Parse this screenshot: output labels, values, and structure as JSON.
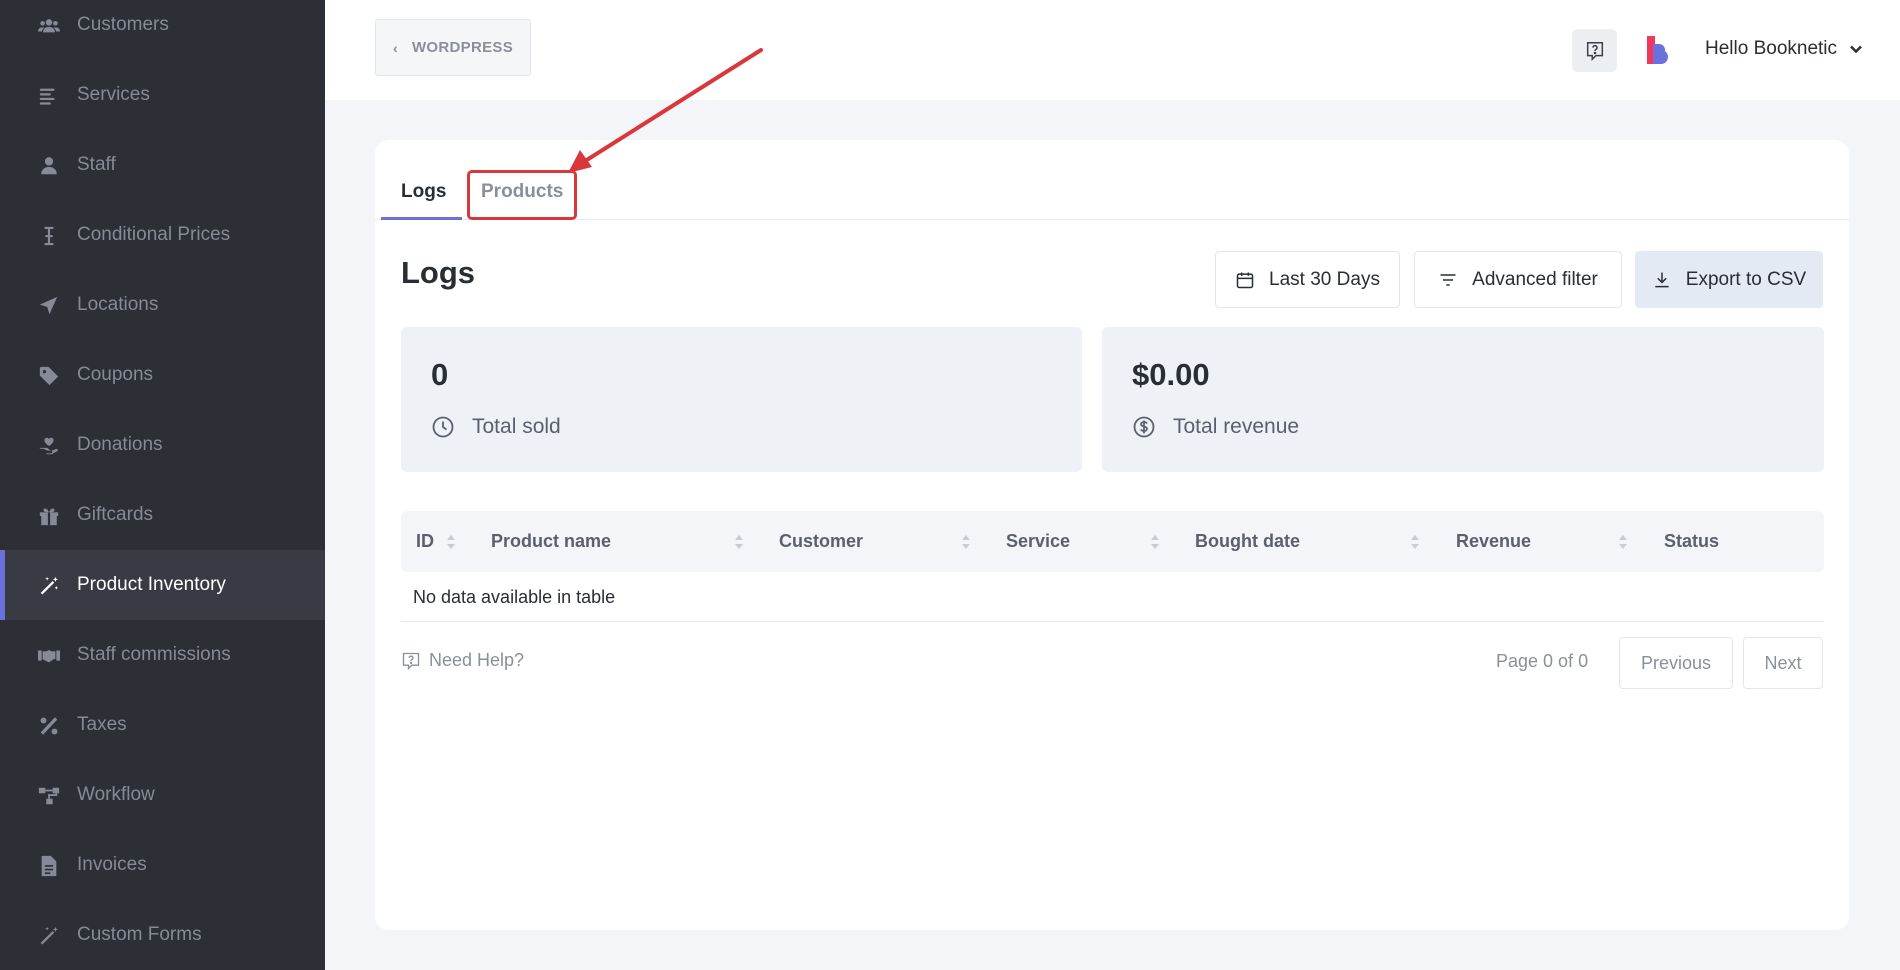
{
  "sidebar": {
    "items": [
      {
        "label": "Customers",
        "icon": "users-icon"
      },
      {
        "label": "Services",
        "icon": "list-icon"
      },
      {
        "label": "Staff",
        "icon": "user-icon"
      },
      {
        "label": "Conditional Prices",
        "icon": "cursor-icon"
      },
      {
        "label": "Locations",
        "icon": "location-arrow-icon"
      },
      {
        "label": "Coupons",
        "icon": "tag-icon"
      },
      {
        "label": "Donations",
        "icon": "hand-heart-icon"
      },
      {
        "label": "Giftcards",
        "icon": "gift-icon"
      },
      {
        "label": "Product Inventory",
        "icon": "magic-wand-icon",
        "active": true
      },
      {
        "label": "Staff commissions",
        "icon": "handshake-icon"
      },
      {
        "label": "Taxes",
        "icon": "percent-icon"
      },
      {
        "label": "Workflow",
        "icon": "workflow-icon"
      },
      {
        "label": "Invoices",
        "icon": "file-icon"
      },
      {
        "label": "Custom Forms",
        "icon": "magic-wand-icon"
      }
    ]
  },
  "topbar": {
    "back_label": "WORDPRESS",
    "user_label": "Hello Booknetic"
  },
  "tabs": [
    {
      "label": "Logs",
      "active": true
    },
    {
      "label": "Products",
      "active": false
    }
  ],
  "main": {
    "title": "Logs",
    "date_filter_label": "Last 30 Days",
    "advanced_filter_label": "Advanced filter",
    "export_label": "Export to CSV",
    "stats": {
      "total_sold_value": "0",
      "total_sold_label": "Total sold",
      "total_revenue_value": "$0.00",
      "total_revenue_label": "Total revenue"
    },
    "table": {
      "columns": [
        "ID",
        "Product name",
        "Customer",
        "Service",
        "Bought date",
        "Revenue",
        "Status"
      ],
      "empty_message": "No data available in table"
    },
    "footer": {
      "help_label": "Need Help?",
      "page_info": "Page 0 of 0",
      "prev_label": "Previous",
      "next_label": "Next"
    }
  },
  "colors": {
    "sidebar_bg": "#2c2f36",
    "accent": "#6c70dc",
    "annotation_red": "#d8383c"
  }
}
